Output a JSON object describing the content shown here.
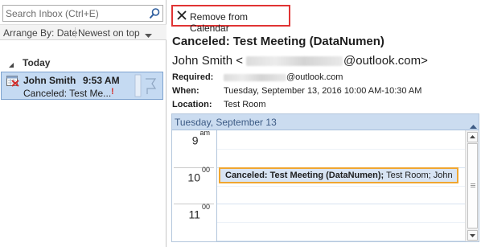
{
  "search": {
    "placeholder": "Search Inbox (Ctrl+E)",
    "icon": "search-icon"
  },
  "arrange": {
    "label": "Arrange By: Date",
    "sort": "Newest on top"
  },
  "inbox": {
    "group_label": "Today",
    "items": [
      {
        "from": "John Smith",
        "time": "9:53 AM",
        "subject": "Canceled: Test Me...",
        "importance": "!"
      }
    ]
  },
  "toolbar": {
    "remove_label": "Remove from Calendar"
  },
  "message": {
    "subject": "Canceled: Test Meeting (DataNumen)",
    "sender_name": "John Smith <",
    "sender_domain": "@outlook.com>",
    "required_label": "Required:",
    "required_domain": "@outlook.com",
    "when_label": "When:",
    "when_value": "Tuesday, September 13, 2016 10:00 AM-10:30 AM",
    "location_label": "Location:",
    "location_value": "Test Room"
  },
  "calendar": {
    "date_header": "Tuesday, September 13",
    "hours": [
      {
        "hour": "9",
        "suffix": "am"
      },
      {
        "hour": "10",
        "suffix": "00"
      },
      {
        "hour": "11",
        "suffix": "00"
      }
    ],
    "event": {
      "title": "Canceled: Test Meeting (DataNumen);",
      "details": " Test Room; John"
    }
  },
  "colors": {
    "selection": "#c5daf2",
    "remove_border": "#e03434",
    "calendar_header": "#cbdcf0",
    "event_border": "#f0a630",
    "event_fill": "#d8e4f3"
  }
}
